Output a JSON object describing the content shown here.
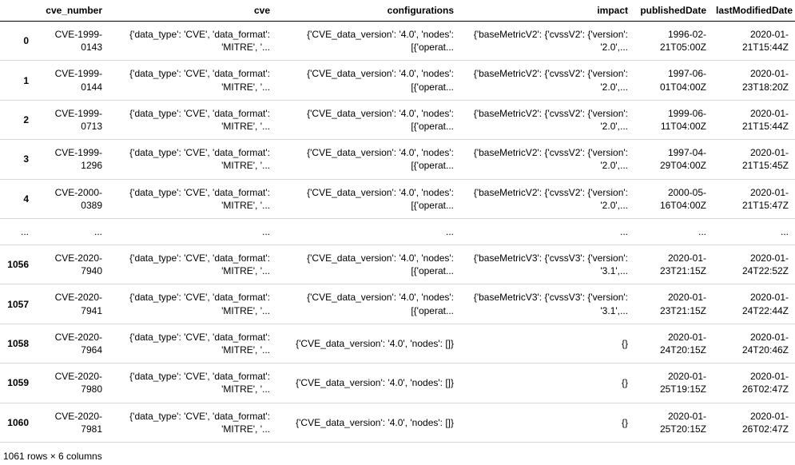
{
  "columns": {
    "idx": "",
    "cve_number": "cve_number",
    "cve": "cve",
    "configurations": "configurations",
    "impact": "impact",
    "publishedDate": "publishedDate",
    "lastModifiedDate": "lastModifiedDate"
  },
  "rows_top": [
    {
      "idx": "0",
      "cve_number": "CVE-1999-\n0143",
      "cve": "{'data_type': 'CVE', 'data_format':\n'MITRE', '...",
      "configurations": "{'CVE_data_version': '4.0', 'nodes':\n[{'operat...",
      "impact": "{'baseMetricV2': {'cvssV2': {'version':\n'2.0',...",
      "publishedDate": "1996-02-\n21T05:00Z",
      "lastModifiedDate": "2020-01-\n21T15:44Z"
    },
    {
      "idx": "1",
      "cve_number": "CVE-1999-\n0144",
      "cve": "{'data_type': 'CVE', 'data_format':\n'MITRE', '...",
      "configurations": "{'CVE_data_version': '4.0', 'nodes':\n[{'operat...",
      "impact": "{'baseMetricV2': {'cvssV2': {'version':\n'2.0',...",
      "publishedDate": "1997-06-\n01T04:00Z",
      "lastModifiedDate": "2020-01-\n23T18:20Z"
    },
    {
      "idx": "2",
      "cve_number": "CVE-1999-\n0713",
      "cve": "{'data_type': 'CVE', 'data_format':\n'MITRE', '...",
      "configurations": "{'CVE_data_version': '4.0', 'nodes':\n[{'operat...",
      "impact": "{'baseMetricV2': {'cvssV2': {'version':\n'2.0',...",
      "publishedDate": "1999-06-\n11T04:00Z",
      "lastModifiedDate": "2020-01-\n21T15:44Z"
    },
    {
      "idx": "3",
      "cve_number": "CVE-1999-\n1296",
      "cve": "{'data_type': 'CVE', 'data_format':\n'MITRE', '...",
      "configurations": "{'CVE_data_version': '4.0', 'nodes':\n[{'operat...",
      "impact": "{'baseMetricV2': {'cvssV2': {'version':\n'2.0',...",
      "publishedDate": "1997-04-\n29T04:00Z",
      "lastModifiedDate": "2020-01-\n21T15:45Z"
    },
    {
      "idx": "4",
      "cve_number": "CVE-2000-\n0389",
      "cve": "{'data_type': 'CVE', 'data_format':\n'MITRE', '...",
      "configurations": "{'CVE_data_version': '4.0', 'nodes':\n[{'operat...",
      "impact": "{'baseMetricV2': {'cvssV2': {'version':\n'2.0',...",
      "publishedDate": "2000-05-\n16T04:00Z",
      "lastModifiedDate": "2020-01-\n21T15:47Z"
    }
  ],
  "ellipsis": {
    "idx": "...",
    "cve_number": "...",
    "cve": "...",
    "configurations": "...",
    "impact": "...",
    "publishedDate": "...",
    "lastModifiedDate": "..."
  },
  "rows_bottom": [
    {
      "idx": "1056",
      "cve_number": "CVE-2020-\n7940",
      "cve": "{'data_type': 'CVE', 'data_format':\n'MITRE', '...",
      "configurations": "{'CVE_data_version': '4.0', 'nodes':\n[{'operat...",
      "impact": "{'baseMetricV3': {'cvssV3': {'version':\n'3.1',...",
      "publishedDate": "2020-01-\n23T21:15Z",
      "lastModifiedDate": "2020-01-\n24T22:52Z"
    },
    {
      "idx": "1057",
      "cve_number": "CVE-2020-\n7941",
      "cve": "{'data_type': 'CVE', 'data_format':\n'MITRE', '...",
      "configurations": "{'CVE_data_version': '4.0', 'nodes':\n[{'operat...",
      "impact": "{'baseMetricV3': {'cvssV3': {'version':\n'3.1',...",
      "publishedDate": "2020-01-\n23T21:15Z",
      "lastModifiedDate": "2020-01-\n24T22:44Z"
    },
    {
      "idx": "1058",
      "cve_number": "CVE-2020-\n7964",
      "cve": "{'data_type': 'CVE', 'data_format':\n'MITRE', '...",
      "configurations": "{'CVE_data_version': '4.0', 'nodes': []}",
      "impact": "{}",
      "publishedDate": "2020-01-\n24T20:15Z",
      "lastModifiedDate": "2020-01-\n24T20:46Z"
    },
    {
      "idx": "1059",
      "cve_number": "CVE-2020-\n7980",
      "cve": "{'data_type': 'CVE', 'data_format':\n'MITRE', '...",
      "configurations": "{'CVE_data_version': '4.0', 'nodes': []}",
      "impact": "{}",
      "publishedDate": "2020-01-\n25T19:15Z",
      "lastModifiedDate": "2020-01-\n26T02:47Z"
    },
    {
      "idx": "1060",
      "cve_number": "CVE-2020-\n7981",
      "cve": "{'data_type': 'CVE', 'data_format':\n'MITRE', '...",
      "configurations": "{'CVE_data_version': '4.0', 'nodes': []}",
      "impact": "{}",
      "publishedDate": "2020-01-\n25T20:15Z",
      "lastModifiedDate": "2020-01-\n26T02:47Z"
    }
  ],
  "footer": "1061 rows × 6 columns"
}
